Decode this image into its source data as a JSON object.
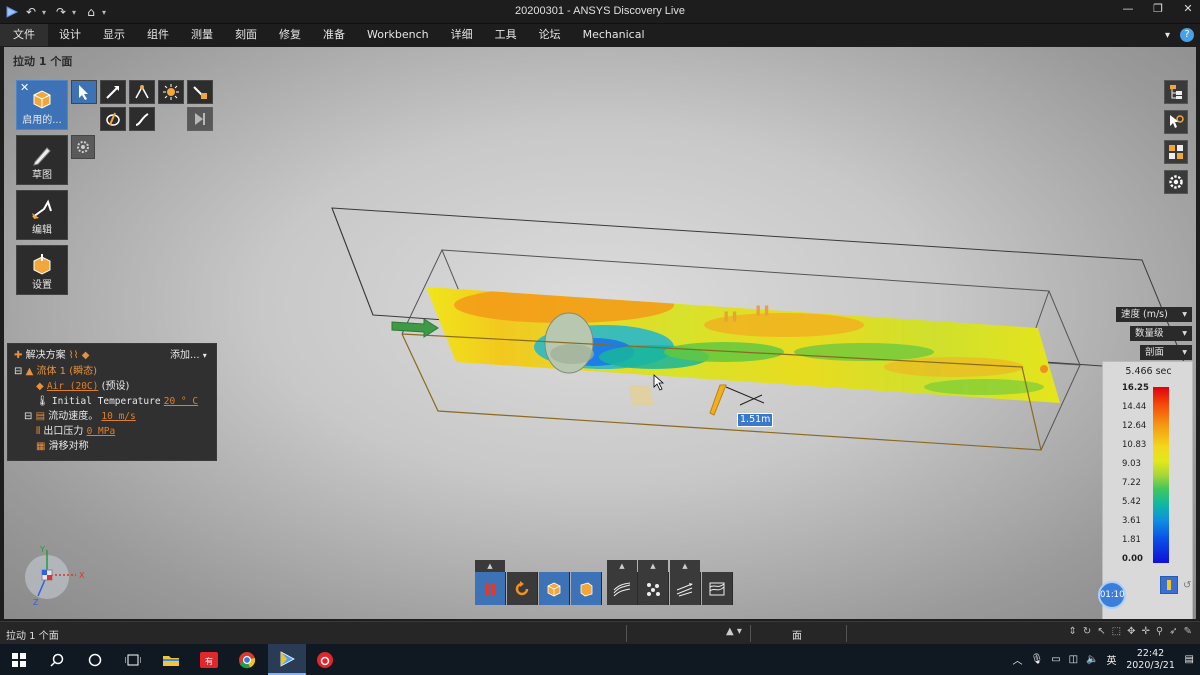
{
  "window": {
    "title": "20200301 - ANSYS Discovery Live",
    "minimize": "—",
    "restore": "❐",
    "close": "✕"
  },
  "menu": {
    "items": [
      "文件",
      "设计",
      "显示",
      "组件",
      "测量",
      "刻面",
      "修复",
      "准备",
      "Workbench",
      "详细",
      "工具",
      "论坛",
      "Mechanical"
    ]
  },
  "viewport": {
    "title": "拉动 1 个面",
    "dimension_label": "1.51m"
  },
  "left_tools": {
    "enable_label": "启用的...",
    "sketch_label": "草图",
    "edit_label": "编辑",
    "settings_label": "设置"
  },
  "tree": {
    "header": "解决方案",
    "add_label": "添加...",
    "fluid": "流体 1 (瞬态)",
    "material_link": "Air (20C)",
    "material_note": "(预设)",
    "temp_label": "Initial Temperature",
    "temp_value": "20 ° C",
    "velocity_label": "流动速度。",
    "velocity_value": "10 m/s",
    "outlet_label": "出口压力",
    "outlet_value": "0 MPa",
    "symmetry_label": "滑移对称"
  },
  "result_controls": {
    "quantity": "速度 (m/s)",
    "mode": "数量级",
    "view": "剖面"
  },
  "legend": {
    "time": "5.466 sec",
    "ticks": [
      "16.25",
      "14.44",
      "12.64",
      "10.83",
      "9.03",
      "7.22",
      "5.42",
      "3.61",
      "1.81",
      "0.00"
    ],
    "clock": "01:10"
  },
  "statusbar": {
    "text": "拉动 1 个面",
    "face_label": "面"
  },
  "taskbar": {
    "time": "22:42",
    "date": "2020/3/21",
    "ime": "英"
  },
  "colors": {
    "accent": "#3e72b6",
    "orange": "#e07f2a",
    "titlebar": "#1d1d1d"
  }
}
